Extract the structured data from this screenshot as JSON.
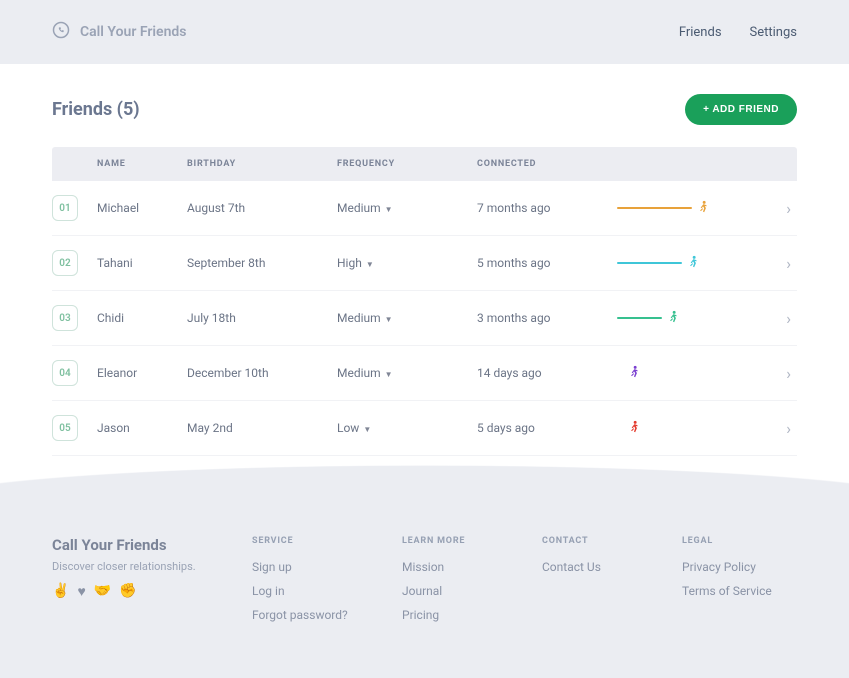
{
  "header": {
    "brand": "Call Your Friends",
    "nav": {
      "friends": "Friends",
      "settings": "Settings"
    }
  },
  "page": {
    "title": "Friends (5)",
    "add_button": "+ ADD FRIEND",
    "columns": {
      "name": "NAME",
      "birthday": "BIRTHDAY",
      "frequency": "FREQUENCY",
      "connected": "CONNECTED"
    }
  },
  "friends": [
    {
      "num": "01",
      "name": "Michael",
      "birthday": "August 7th",
      "frequency": "Medium",
      "connected": "7 months ago",
      "color": "#e8a23a",
      "offset": 0,
      "line": 75
    },
    {
      "num": "02",
      "name": "Tahani",
      "birthday": "September 8th",
      "frequency": "High",
      "connected": "5 months ago",
      "color": "#3fc6d8",
      "offset": 0,
      "line": 65
    },
    {
      "num": "03",
      "name": "Chidi",
      "birthday": "July 18th",
      "frequency": "Medium",
      "connected": "3 months ago",
      "color": "#36c08f",
      "offset": 0,
      "line": 45
    },
    {
      "num": "04",
      "name": "Eleanor",
      "birthday": "December 10th",
      "frequency": "Medium",
      "connected": "14 days ago",
      "color": "#7a3fd0",
      "offset": 10,
      "line": 0
    },
    {
      "num": "05",
      "name": "Jason",
      "birthday": "May 2nd",
      "frequency": "Low",
      "connected": "5 days ago",
      "color": "#e33b2e",
      "offset": 10,
      "line": 0
    }
  ],
  "footer": {
    "brand_title": "Call Your Friends",
    "tagline": "Discover closer relationships.",
    "service": {
      "head": "SERVICE",
      "signup": "Sign up",
      "login": "Log in",
      "forgot": "Forgot password?"
    },
    "learn": {
      "head": "LEARN MORE",
      "mission": "Mission",
      "journal": "Journal",
      "pricing": "Pricing"
    },
    "contact": {
      "head": "CONTACT",
      "contact_us": "Contact Us"
    },
    "legal": {
      "head": "LEGAL",
      "privacy": "Privacy Policy",
      "tos": "Terms of Service"
    }
  }
}
